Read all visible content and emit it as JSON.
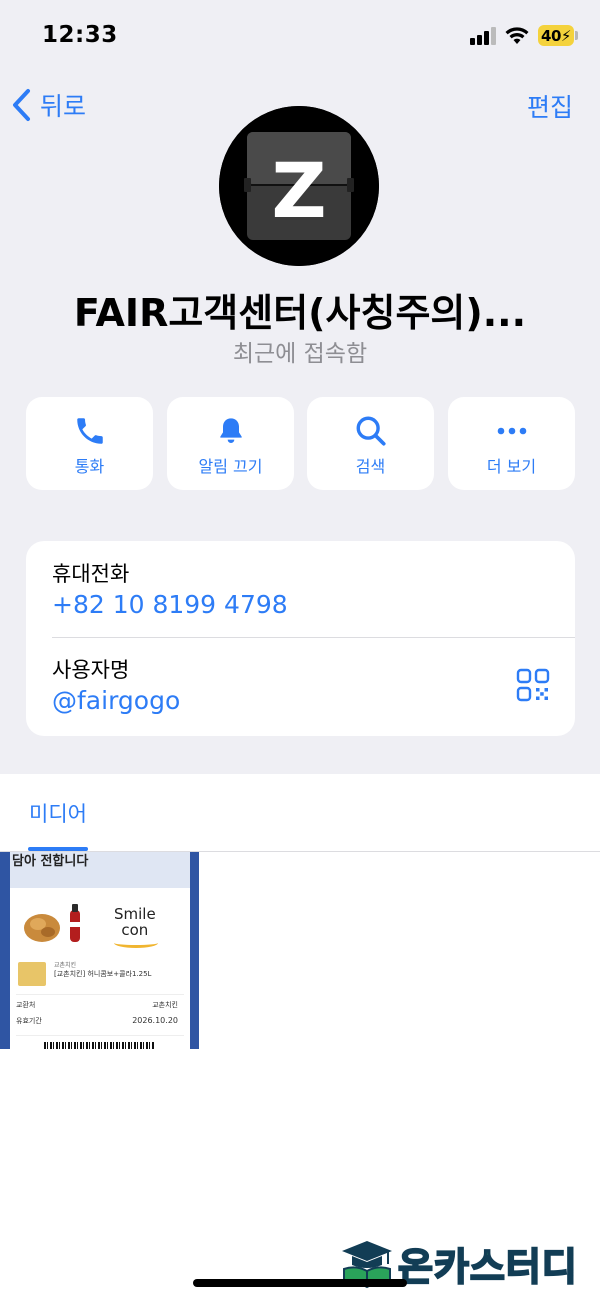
{
  "status_bar": {
    "time": "12:33",
    "battery": "40"
  },
  "nav": {
    "back_label": "뒤로",
    "edit_label": "편집"
  },
  "profile": {
    "avatar_letter": "Z",
    "name": "FAIR고객센터(사칭주의)...",
    "last_seen": "최근에 접속함"
  },
  "actions": [
    {
      "label": "통화",
      "icon": "phone-icon"
    },
    {
      "label": "알림 끄기",
      "icon": "bell-icon"
    },
    {
      "label": "검색",
      "icon": "search-icon"
    },
    {
      "label": "더 보기",
      "icon": "more-icon"
    }
  ],
  "info": {
    "phone_label": "휴대전화",
    "phone_value": "+82 10 8199 4798",
    "username_label": "사용자명",
    "username_value": "@fairgogo"
  },
  "media": {
    "tab_label": "미디어",
    "thumbnail": {
      "heading": "담아 전합니다",
      "brand_line1": "Smile",
      "brand_line2": "con",
      "shop_small": "교촌치킨",
      "product": "[교촌치킨] 허니콤보+콜라1.25L",
      "exchange_label": "교환처",
      "exchange_value": "교촌치킨",
      "validity_label": "유효기간",
      "validity_value": "2026.10.20"
    }
  },
  "watermark": {
    "text": "온카스터디"
  },
  "colors": {
    "accent": "#2d7cf6",
    "background_grey": "#efeff4",
    "battery": "#f4d23c",
    "watermark_green": "#2aa35a"
  }
}
